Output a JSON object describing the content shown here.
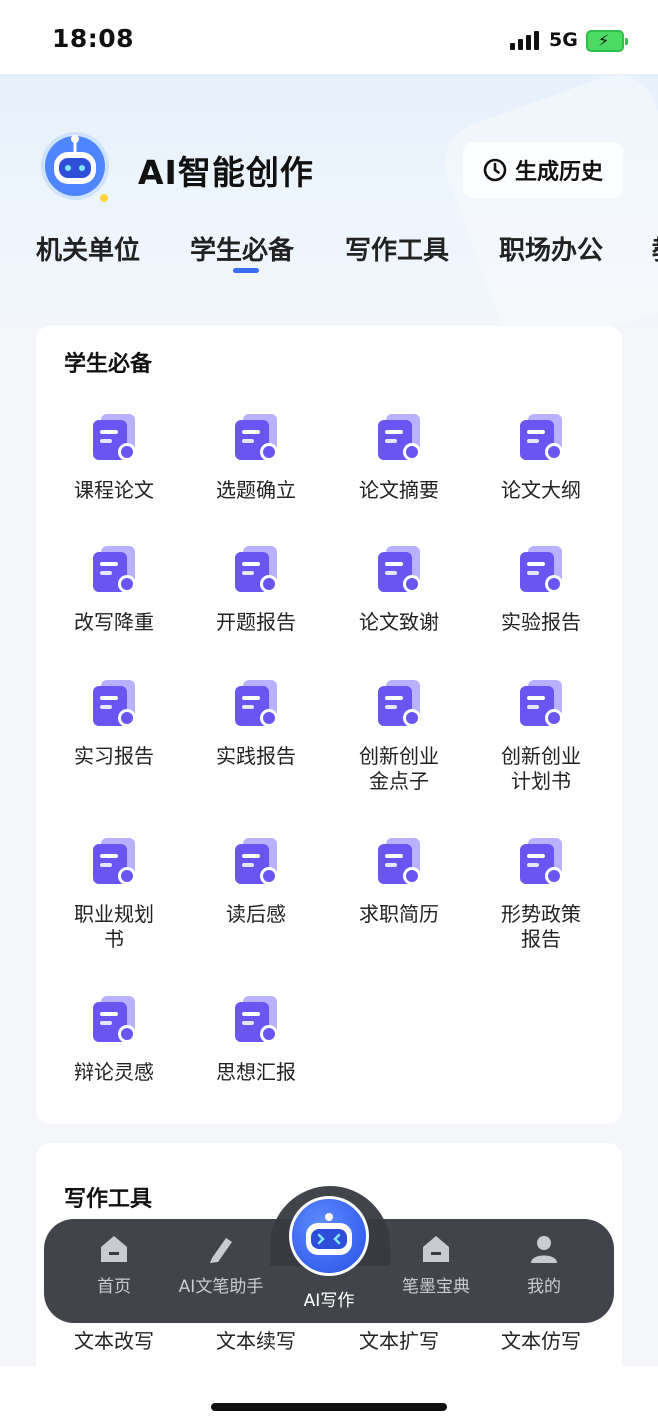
{
  "status": {
    "time": "18:08",
    "network": "5G"
  },
  "header": {
    "title": "AI智能创作",
    "history_label": "生成历史",
    "tabs": [
      "机关单位",
      "学生必备",
      "写作工具",
      "职场办公",
      "教"
    ],
    "active_tab": "学生必备"
  },
  "student_section": {
    "title": "学生必备",
    "items": [
      {
        "label": "课程论文",
        "icon": "document-pen-icon"
      },
      {
        "label": "选题确立",
        "icon": "checklist-star-icon"
      },
      {
        "label": "论文摘要",
        "icon": "quote-clipboard-icon"
      },
      {
        "label": "论文大纲",
        "icon": "outline-tree-icon"
      },
      {
        "label": "改写降重",
        "icon": "search-document-icon"
      },
      {
        "label": "开题报告",
        "icon": "document-edit-icon"
      },
      {
        "label": "论文致谢",
        "icon": "text-heart-icon"
      },
      {
        "label": "实验报告",
        "icon": "experiment-graph-icon"
      },
      {
        "label": "实习报告",
        "icon": "clipboard-tie-icon"
      },
      {
        "label": "实践报告",
        "icon": "clipboard-chart-icon"
      },
      {
        "label": "创新创业\n金点子",
        "icon": "upload-document-icon"
      },
      {
        "label": "创新创业\n计划书",
        "icon": "flag-document-icon"
      },
      {
        "label": "职业规划\n书",
        "icon": "tie-book-icon"
      },
      {
        "label": "读后感",
        "icon": "play-document-icon"
      },
      {
        "label": "求职简历",
        "icon": "resume-person-icon"
      },
      {
        "label": "形势政策\n报告",
        "icon": "trend-clipboard-icon"
      },
      {
        "label": "辩论灵感",
        "icon": "debate-person-icon"
      },
      {
        "label": "思想汇报",
        "icon": "clipboard-pen-icon"
      }
    ]
  },
  "writing_section": {
    "title": "写作工具",
    "items": [
      "文本改写",
      "文本续写",
      "文本扩写",
      "文本仿写"
    ]
  },
  "nav": {
    "items": [
      {
        "label": "首页",
        "icon": "home-icon"
      },
      {
        "label": "AI文笔助手",
        "icon": "pen-icon"
      },
      {
        "label": "AI写作",
        "icon": "robot-icon"
      },
      {
        "label": "笔墨宝典",
        "icon": "book-icon"
      },
      {
        "label": "我的",
        "icon": "person-icon"
      }
    ]
  },
  "colors": {
    "accent": "#3b6df5",
    "icon_purple": "#6a55f0",
    "icon_light": "#b9b0ff"
  }
}
